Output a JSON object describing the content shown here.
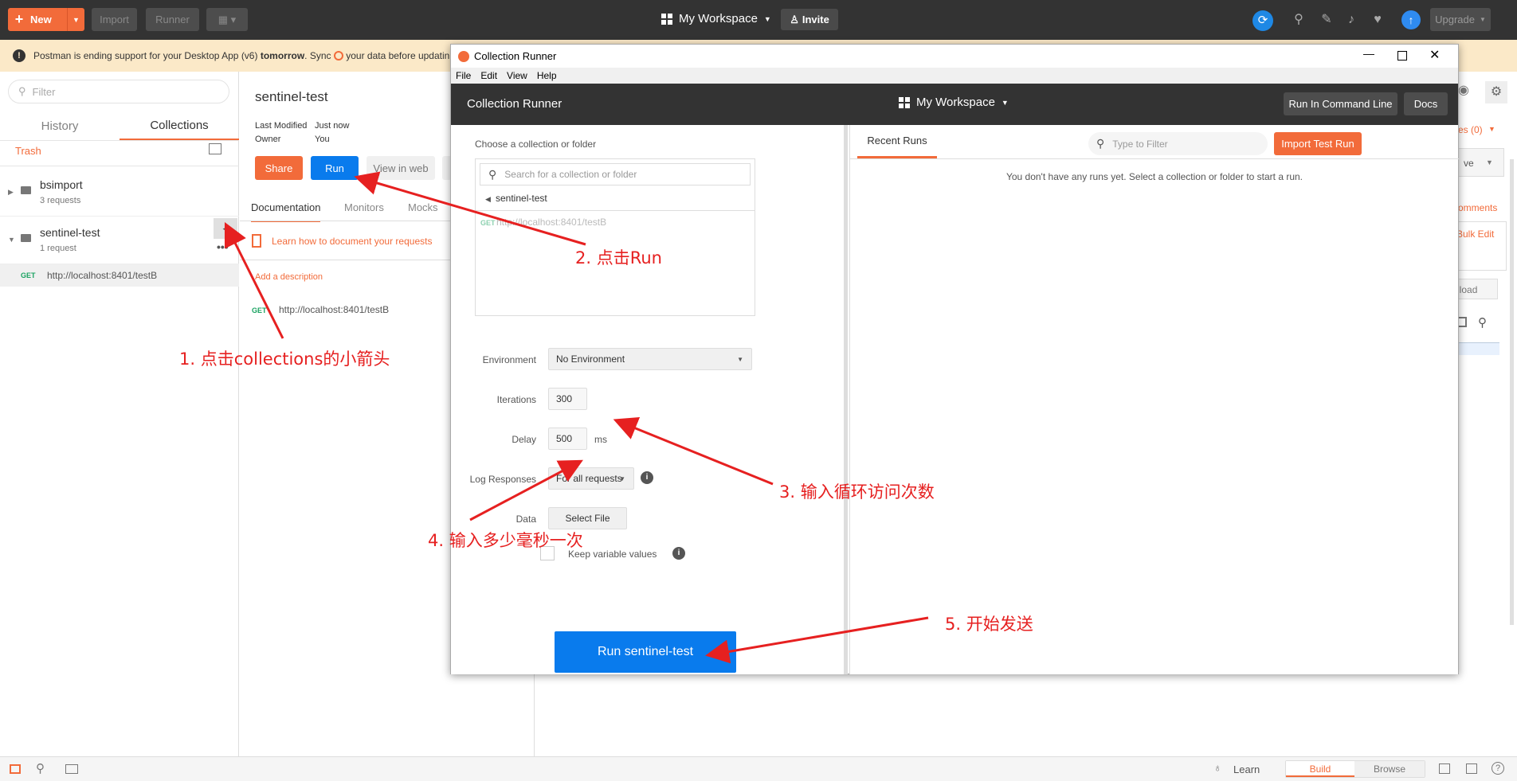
{
  "topbar": {
    "new_label": "New",
    "import_label": "Import",
    "runner_label": "Runner",
    "workspace_label": "My Workspace",
    "invite_label": "Invite",
    "upgrade_label": "Upgrade"
  },
  "banner": {
    "text_prefix": "Postman is ending support for your Desktop App (v6)",
    "text_bold": "tomorrow",
    "text_mid": ". Sync",
    "text_suffix": "your data before updatin"
  },
  "sidebar": {
    "filter_placeholder": "Filter",
    "tab_history": "History",
    "tab_collections": "Collections",
    "trash_label": "Trash",
    "collections": [
      {
        "name": "bsimport",
        "count": "3 requests"
      },
      {
        "name": "sentinel-test",
        "count": "1 request"
      }
    ],
    "request": {
      "method": "GET",
      "url": "http://localhost:8401/testB"
    }
  },
  "main": {
    "title": "sentinel-test",
    "last_modified_label": "Last Modified",
    "last_modified_value": "Just now",
    "owner_label": "Owner",
    "owner_value": "You",
    "share_label": "Share",
    "run_label": "Run",
    "view_web_label": "View in web",
    "tabs": [
      "Documentation",
      "Monitors",
      "Mocks"
    ],
    "learn_link": "Learn how to document your requests",
    "add_description": "Add a description",
    "request_method": "GET",
    "request_url": "http://localhost:8401/testB",
    "right_fragments": {
      "changes": "es (0)",
      "ve": "ve",
      "comments": "omments",
      "bulk_edit": "Bulk Edit",
      "download": "nload"
    }
  },
  "runner": {
    "window_title": "Collection Runner",
    "menu": [
      "File",
      "Edit",
      "View",
      "Help"
    ],
    "header_title": "Collection Runner",
    "workspace_label": "My Workspace",
    "command_line_label": "Run In Command Line",
    "docs_label": "Docs",
    "choose_label": "Choose a collection or folder",
    "search_placeholder": "Search for a collection or folder",
    "breadcrumb": "sentinel-test",
    "request_method": "GET",
    "request_url": "http://localhost:8401/testB",
    "environment_label": "Environment",
    "environment_value": "No Environment",
    "iterations_label": "Iterations",
    "iterations_value": "300",
    "delay_label": "Delay",
    "delay_value": "500",
    "delay_unit": "ms",
    "log_label": "Log Responses",
    "log_value": "For all requests",
    "data_label": "Data",
    "select_file_label": "Select File",
    "keep_vars_label": "Keep variable values",
    "run_button_label": "Run sentinel-test",
    "recent_runs_tab": "Recent Runs",
    "filter_placeholder": "Type to Filter",
    "import_label": "Import Test Run",
    "empty_message": "You don't have any runs yet. Select a collection or folder to start a run."
  },
  "statusbar": {
    "learn_label": "Learn",
    "build_label": "Build",
    "browse_label": "Browse"
  },
  "annotations": {
    "a1": "1. 点击collections的小箭头",
    "a2": "2. 点击Run",
    "a3": "3. 输入循环访问次数",
    "a4": "4. 输入多少毫秒一次",
    "a5": "5. 开始发送"
  },
  "colors": {
    "accent": "#f26b3a",
    "primary": "#097bed",
    "topbar_bg": "#333333",
    "banner_bg": "#fbe9c8",
    "annotation": "#e62020"
  }
}
